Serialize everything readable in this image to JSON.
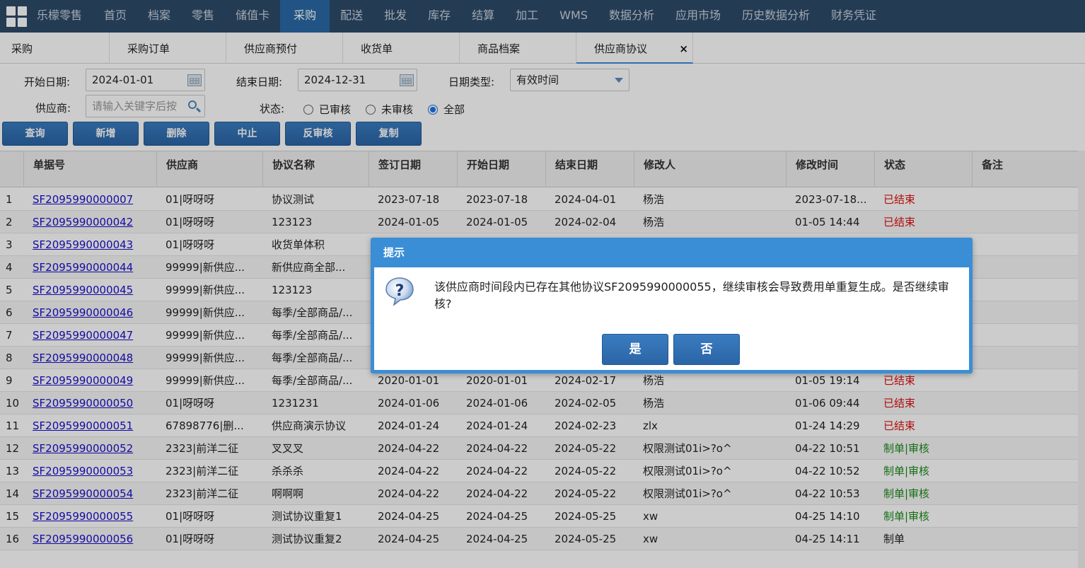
{
  "nav": {
    "brand": "乐檬零售",
    "items": [
      "首页",
      "档案",
      "零售",
      "储值卡",
      "采购",
      "配送",
      "批发",
      "库存",
      "结算",
      "加工",
      "WMS",
      "数据分析",
      "应用市场",
      "历史数据分析",
      "财务凭证"
    ],
    "active": "采购"
  },
  "tabs": [
    "采购",
    "采购订单",
    "供应商预付",
    "收货单",
    "商品档案",
    "供应商协议"
  ],
  "tab_close": "×",
  "filters": {
    "start_label": "开始日期:",
    "start_value": "2024-01-01",
    "end_label": "结束日期:",
    "end_value": "2024-12-31",
    "date_type_label": "日期类型:",
    "date_type_value": "有效时间",
    "supplier_label": "供应商:",
    "supplier_placeholder": "请输入关键字后按",
    "status_label": "状态:",
    "status_options": [
      "已审核",
      "未审核",
      "全部"
    ],
    "status_selected": "全部"
  },
  "buttons": [
    "查询",
    "新增",
    "删除",
    "中止",
    "反审核",
    "复制"
  ],
  "table": {
    "headers": [
      "单据号",
      "供应商",
      "协议名称",
      "签订日期",
      "开始日期",
      "结束日期",
      "修改人",
      "修改时间",
      "状态",
      "备注"
    ],
    "rows": [
      [
        "1",
        "SF2095990000007",
        "01|呀呀呀",
        "协议测试",
        "2023-07-18",
        "2023-07-18",
        "2024-04-01",
        "杨浩",
        "2023-07-18...",
        "已结束",
        ""
      ],
      [
        "2",
        "SF2095990000042",
        "01|呀呀呀",
        "123123",
        "2024-01-05",
        "2024-01-05",
        "2024-02-04",
        "杨浩",
        "01-05 14:44",
        "已结束",
        ""
      ],
      [
        "3",
        "SF2095990000043",
        "01|呀呀呀",
        "收货单体积",
        "",
        "",
        "",
        "",
        "",
        "",
        ""
      ],
      [
        "4",
        "SF2095990000044",
        "99999|新供应...",
        "新供应商全部...",
        "",
        "",
        "",
        "",
        "",
        "",
        ""
      ],
      [
        "5",
        "SF2095990000045",
        "99999|新供应...",
        "123123",
        "",
        "",
        "",
        "",
        "",
        "",
        ""
      ],
      [
        "6",
        "SF2095990000046",
        "99999|新供应...",
        "每季/全部商品/...",
        "",
        "",
        "",
        "",
        "",
        "",
        ""
      ],
      [
        "7",
        "SF2095990000047",
        "99999|新供应...",
        "每季/全部商品/...",
        "",
        "",
        "",
        "",
        "",
        "",
        ""
      ],
      [
        "8",
        "SF2095990000048",
        "99999|新供应...",
        "每季/全部商品/...",
        "",
        "",
        "",
        "",
        "",
        "",
        ""
      ],
      [
        "9",
        "SF2095990000049",
        "99999|新供应...",
        "每季/全部商品/...",
        "2020-01-01",
        "2020-01-01",
        "2024-02-17",
        "杨浩",
        "01-05 19:14",
        "已结束",
        ""
      ],
      [
        "10",
        "SF2095990000050",
        "01|呀呀呀",
        "1231231",
        "2024-01-06",
        "2024-01-06",
        "2024-02-05",
        "杨浩",
        "01-06 09:44",
        "已结束",
        ""
      ],
      [
        "11",
        "SF2095990000051",
        "67898776|删...",
        "供应商演示协议",
        "2024-01-24",
        "2024-01-24",
        "2024-02-23",
        "zlx",
        "01-24 14:29",
        "已结束",
        ""
      ],
      [
        "12",
        "SF2095990000052",
        "2323|前洋二征",
        "叉叉叉",
        "2024-04-22",
        "2024-04-22",
        "2024-05-22",
        "权限测试01i>?o^",
        "04-22 10:51",
        "制单|审核",
        ""
      ],
      [
        "13",
        "SF2095990000053",
        "2323|前洋二征",
        "杀杀杀",
        "2024-04-22",
        "2024-04-22",
        "2024-05-22",
        "权限测试01i>?o^",
        "04-22 10:52",
        "制单|审核",
        ""
      ],
      [
        "14",
        "SF2095990000054",
        "2323|前洋二征",
        "啊啊啊",
        "2024-04-22",
        "2024-04-22",
        "2024-05-22",
        "权限测试01i>?o^",
        "04-22 10:53",
        "制单|审核",
        ""
      ],
      [
        "15",
        "SF2095990000055",
        "01|呀呀呀",
        "测试协议重复1",
        "2024-04-25",
        "2024-04-25",
        "2024-05-25",
        "xw",
        "04-25 14:10",
        "制单|审核",
        ""
      ],
      [
        "16",
        "SF2095990000056",
        "01|呀呀呀",
        "测试协议重复2",
        "2024-04-25",
        "2024-04-25",
        "2024-05-25",
        "xw",
        "04-25 14:11",
        "制单",
        ""
      ]
    ]
  },
  "dialog": {
    "title": "提示",
    "message": "该供应商时间段内已存在其他协议SF2095990000055，继续审核会导致费用单重复生成。是否继续审核?",
    "yes": "是",
    "no": "否"
  },
  "colors": {
    "nav_bg": "#2d4a6a",
    "nav_active": "#2a6aa5",
    "status_ended": "#e01010",
    "status_approved": "#1a8a1a",
    "dialog": "#3a8ed6"
  }
}
